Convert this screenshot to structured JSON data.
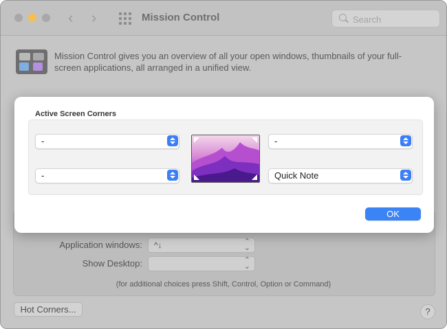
{
  "window": {
    "title": "Mission Control",
    "traffic_lights": {
      "red": "#a8a8a8",
      "yellow": "#f6bf50",
      "green": "#a8a8a8"
    },
    "nav": {
      "back_glyph": "‹",
      "forward_glyph": "›"
    }
  },
  "search": {
    "placeholder": "Search",
    "value": ""
  },
  "description": "Mission Control gives you an overview of all your open windows, thumbnails of your full-screen applications, all arranged in a unified view.",
  "background_settings": {
    "application_windows": {
      "label": "Application windows:",
      "value": "^↓"
    },
    "show_desktop": {
      "label": "Show Desktop:",
      "value": ""
    },
    "hint": "(for additional choices press Shift, Control, Option or Command)",
    "hot_corners_label": "Hot Corners...",
    "help_label": "?"
  },
  "dialog": {
    "title": "Active Screen Corners",
    "corners": {
      "top_left": "-",
      "top_right": "-",
      "bottom_left": "-",
      "bottom_right": "Quick Note"
    },
    "ok_label": "OK",
    "accent": "#3b84f5"
  },
  "icons": [
    "mission-control-icon",
    "grid-icon",
    "search-icon",
    "chevron-left-icon",
    "chevron-right-icon",
    "stepper-icon"
  ]
}
